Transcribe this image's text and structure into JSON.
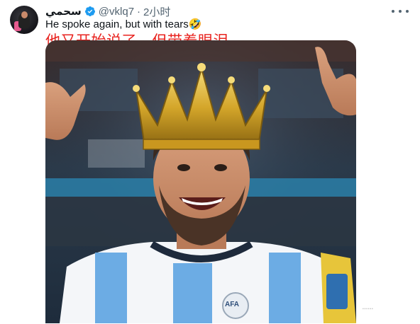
{
  "tweet": {
    "display_name": "سحمي",
    "handle": "@vklq7",
    "separator": "·",
    "time": "2小时",
    "text": "He spoke again, but with tears🤣",
    "overlay_caption": "他又开始说了，但带着眼泪"
  },
  "media": {
    "description_icons": [
      "crown-icon"
    ],
    "badge_text": "AFA"
  },
  "colors": {
    "verified_blue": "#1d9bf0",
    "caption_red": "#e8231f",
    "handle_gray": "#536471",
    "jersey_blue": "#6cace4"
  }
}
